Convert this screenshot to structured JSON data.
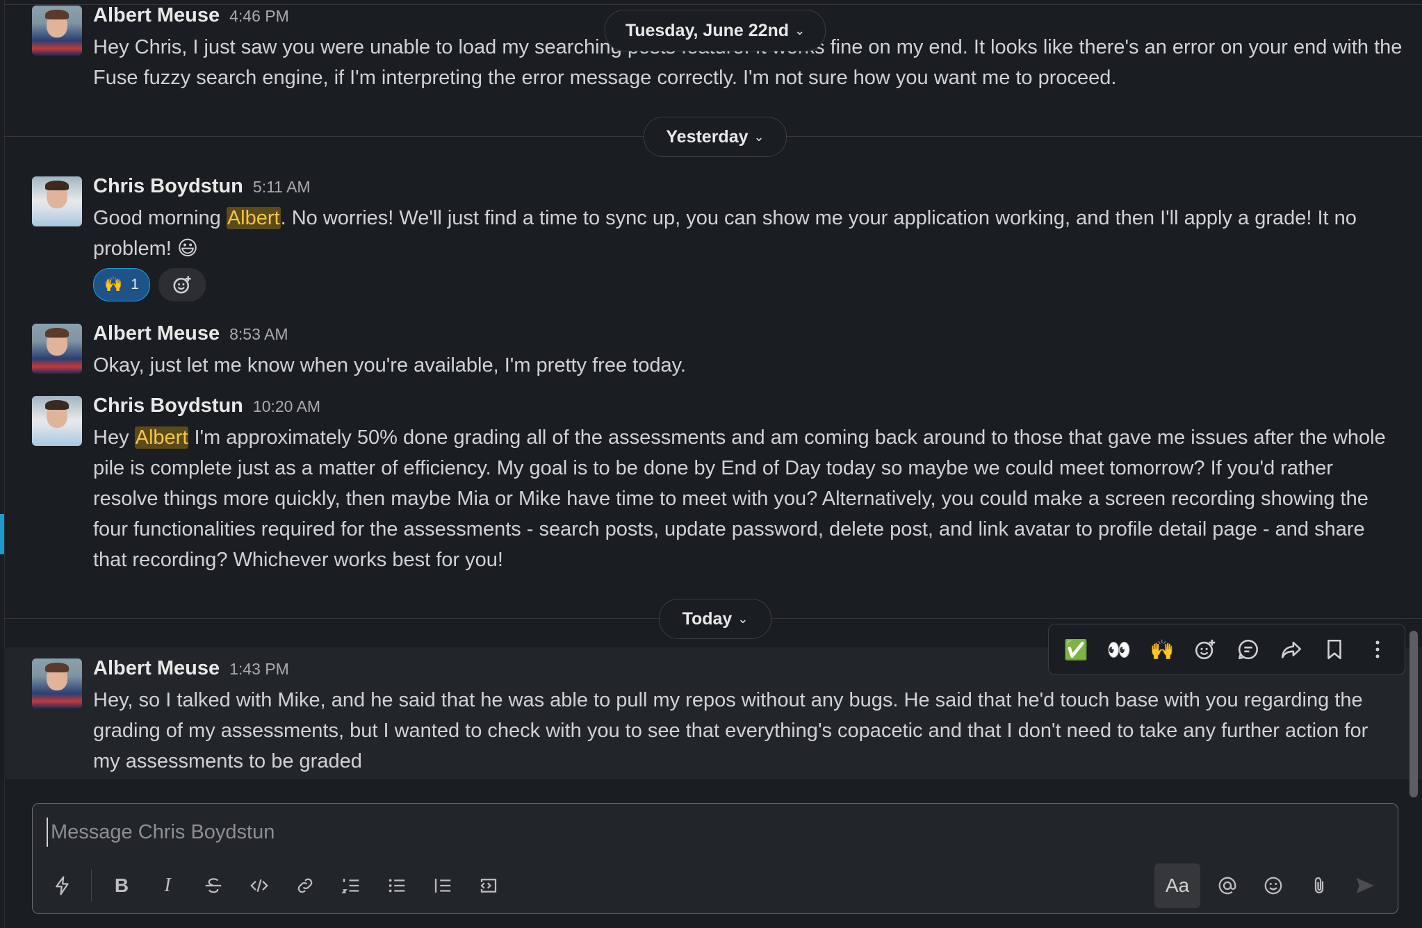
{
  "messages": [
    {
      "author": "Albert Meuse",
      "time": "4:46 PM",
      "text": "Hey Chris, I just saw you were unable to load my searching posts feature. It works fine on my end. It looks like there's an error on your end with the Fuse fuzzy search engine, if I'm interpreting the error message correctly. I'm not sure how you want me to proceed."
    },
    {
      "author": "Chris Boydstun",
      "time": "5:11 AM",
      "text_before": "Good morning ",
      "mention": "Albert",
      "text_after": ". No worries! We'll just find a time to sync up, you can show me your application working, and then I'll apply a grade! It no problem! 😃",
      "reaction": {
        "emoji": "🙌",
        "count": "1"
      }
    },
    {
      "author": "Albert Meuse",
      "time": "8:53 AM",
      "text": "Okay, just let me know when you're available, I'm pretty free today."
    },
    {
      "author": "Chris Boydstun",
      "time": "10:20 AM",
      "text_before": "Hey ",
      "mention": "Albert",
      "text_after": " I'm approximately 50% done grading all of the assessments and am coming back around to those that gave me issues after the whole pile is complete just as a matter of efficiency. My goal is to be done by End of Day today so maybe we could meet tomorrow? If you'd rather resolve things more quickly, then maybe Mia or Mike have time to meet with you? Alternatively, you could make a screen recording showing the four functionalities required for the assessments - search posts, update password, delete post, and link avatar to profile detail page - and share that recording? Whichever works best for you!"
    },
    {
      "author": "Albert Meuse",
      "time": "1:43 PM",
      "text": "Hey,  so I talked with Mike, and he said that he was able to pull my repos without any bugs. He said that he'd touch base with you regarding the grading of my assessments, but I wanted to check with you to see that everything's copacetic and that I don't need to take any further action for my assessments to be graded"
    }
  ],
  "day_dividers": {
    "first": "Tuesday, June 22nd",
    "second": "Yesterday",
    "third": "Today"
  },
  "hover_toolbar": {
    "icons": [
      "white-check-mark-icon",
      "eyes-icon",
      "raised-hands-icon",
      "add-reaction-icon",
      "reply-in-thread-icon",
      "share-icon",
      "bookmark-icon",
      "more-actions-icon"
    ],
    "emoji_check": "✅",
    "emoji_eyes": "👀",
    "emoji_hands": "🙌"
  },
  "composer": {
    "placeholder": "Message Chris Boydstun",
    "aa_label": "Aa",
    "bold_label": "B",
    "italic_label": "I"
  },
  "colors": {
    "background": "#1a1d21",
    "mention_bg": "#5b4a1a",
    "mention_text": "#f2c744",
    "reaction_active": "#1e5389",
    "accent": "#1d9bd1"
  }
}
